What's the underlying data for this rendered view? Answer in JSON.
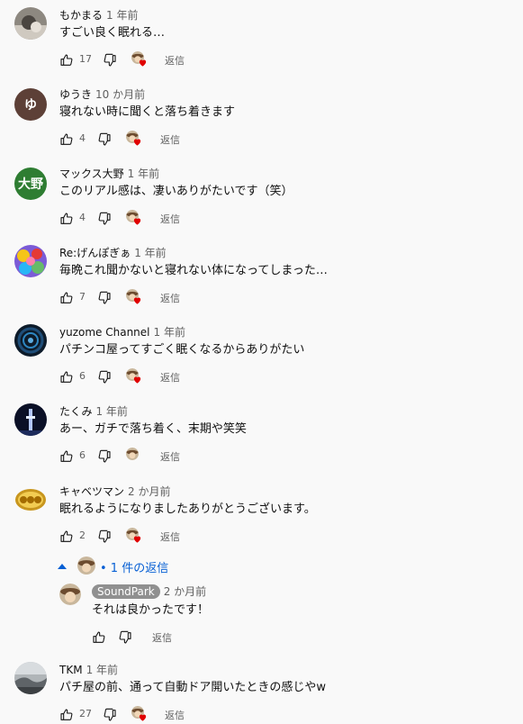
{
  "comments": [
    {
      "author": "もかまる",
      "time": "1 年前",
      "text": "すごい良く眠れる…",
      "likes": "17",
      "reply_label": "返信",
      "avatar": "photo-cat-icon"
    },
    {
      "author": "ゆうき",
      "time": "10 か月前",
      "text": "寝れない時に聞くと落ち着きます",
      "likes": "4",
      "reply_label": "返信",
      "avatar_letter": "ゆ",
      "avatar_color": "#5d4037"
    },
    {
      "author": "マックス大野",
      "time": "1 年前",
      "text": "このリアル感は、凄いありがたいです（笑）",
      "likes": "4",
      "reply_label": "返信",
      "avatar_letter": "大野",
      "avatar_color": "#2e7d32"
    },
    {
      "author": "Re:げんぽぎぁ",
      "time": "1 年前",
      "text": "毎晩これ聞かないと寝れない体になってしまった…",
      "likes": "7",
      "reply_label": "返信",
      "avatar": "colorful-photo-icon"
    },
    {
      "author": "yuzome Channel",
      "time": "1 年前",
      "text": "パチンコ屋ってすごく眠くなるからありがたい",
      "likes": "6",
      "reply_label": "返信",
      "avatar": "spiral-photo-icon"
    },
    {
      "author": "たくみ",
      "time": "1 年前",
      "text": "あー、ガチで落ち着く、末期や笑笑",
      "likes": "6",
      "reply_label": "返信",
      "avatar": "tower-photo-icon"
    },
    {
      "author": "キャベツマン",
      "time": "2 か月前",
      "text": "眠れるようになりましたありがとうございます。",
      "likes": "2",
      "reply_label": "返信",
      "avatar": "god-logo-icon"
    },
    {
      "author": "TKM",
      "time": "1 年前",
      "text": "パチ屋の前、通って自動ドア開いたときの感じやw",
      "likes": "27",
      "reply_label": "返信",
      "avatar": "landscape-photo-icon"
    }
  ],
  "replies_toggle": {
    "label": "• 1 件の返信"
  },
  "reply": {
    "author": "SoundPark",
    "time": "2 か月前",
    "text": "それは良かったです！",
    "reply_label": "返信"
  },
  "colors": {
    "heart": "#e00000",
    "link": "#065fd4"
  }
}
